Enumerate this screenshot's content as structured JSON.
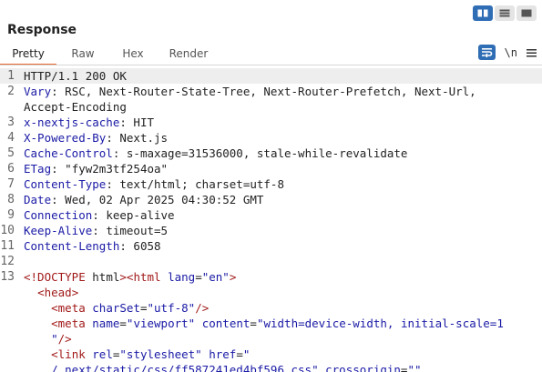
{
  "toolbar": {
    "layout_buttons": [
      {
        "name": "layout-split-vertical",
        "active": true
      },
      {
        "name": "layout-split-horizontal",
        "active": false
      },
      {
        "name": "layout-single",
        "active": false
      }
    ],
    "newline_label": "\\n"
  },
  "panel": {
    "title": "Response",
    "tabs": [
      "Pretty",
      "Raw",
      "Hex",
      "Render"
    ],
    "active_tab": "Pretty"
  },
  "headers": {
    "status_line": "HTTP/1.1 200 OK",
    "vary_name": "Vary",
    "vary_value": " RSC, Next-Router-State-Tree, Next-Router-Prefetch, Next-Url,",
    "vary_value_cont": "Accept-Encoding",
    "cache_name": "x-nextjs-cache",
    "cache_value": " HIT",
    "powered_name": "X-Powered-By",
    "powered_value": " Next.js",
    "cc_name": "Cache-Control",
    "cc_value": " s-maxage=31536000, stale-while-revalidate",
    "etag_name": "ETag",
    "etag_value": " \"fyw2m3tf254oa\"",
    "ct_name": "Content-Type",
    "ct_value": " text/html; charset=utf-8",
    "date_name": "Date",
    "date_value": " Wed, 02 Apr 2025 04:30:52 GMT",
    "conn_name": "Connection",
    "conn_value": " keep-alive",
    "ka_name": "Keep-Alive",
    "ka_value": " timeout=5",
    "cl_name": "Content-Length",
    "cl_value": " 6058"
  },
  "body": {
    "doctype_open": "<",
    "doctype_text": "!DOCTYPE",
    "doctype_name": " html",
    "doctype_close": ">",
    "html_open": "<",
    "html_tag": "html",
    "html_attr": " lang",
    "html_eq": "=",
    "html_val": "\"en\"",
    "html_close": ">",
    "head_indent": "  ",
    "head_open": "<",
    "head_tag": "head",
    "head_close": ">",
    "meta1_indent": "    ",
    "meta1_open": "<",
    "meta1_tag": "meta",
    "meta1_attr": " charSet",
    "meta1_eq": "=",
    "meta1_val": "\"utf-8\"",
    "meta1_close": "/>",
    "meta2_indent": "    ",
    "meta2_open": "<",
    "meta2_tag": "meta",
    "meta2_attr1": " name",
    "meta2_eq1": "=",
    "meta2_val1": "\"viewport\"",
    "meta2_attr2": " content",
    "meta2_eq2": "=",
    "meta2_val2": "\"width=device-width, initial-scale=1",
    "meta2_cont_indent": "    ",
    "meta2_cont_val": "\"",
    "meta2_cont_close": "/>",
    "link_indent": "    ",
    "link_open": "<",
    "link_tag": "link",
    "link_attr1": " rel",
    "link_eq1": "=",
    "link_val1": "\"stylesheet\"",
    "link_attr2": " href",
    "link_eq2": "=",
    "link_val2": "\"",
    "link_cont_indent": "    ",
    "link_cont_val": "/_next/static/css/ff587241ed4bf596.css\"",
    "link_cont_attr": " crossorigin",
    "link_cont_eq": "=",
    "link_cont_val2": "\"\""
  },
  "line_numbers": [
    "1",
    "2",
    "3",
    "4",
    "5",
    "6",
    "7",
    "8",
    "9",
    "10",
    "11",
    "12",
    "13"
  ]
}
